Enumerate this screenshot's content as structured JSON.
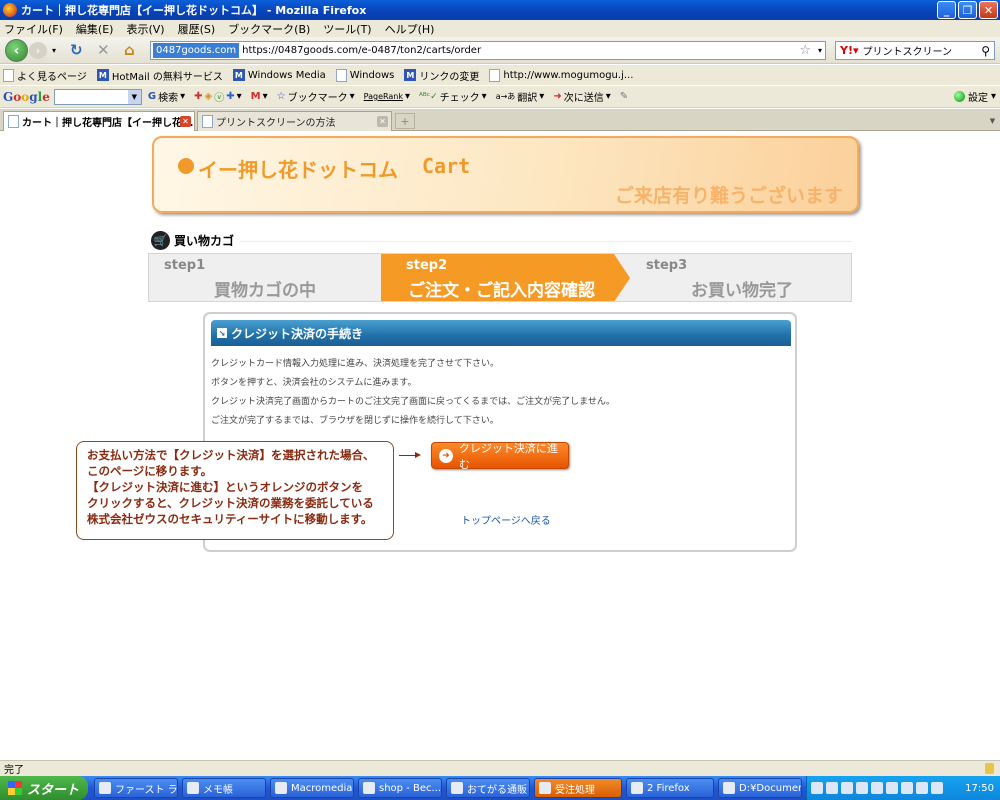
{
  "window": {
    "title": "カート｜押し花専門店【イー押し花ドットコム】 - Mozilla Firefox"
  },
  "menu": [
    "ファイル(F)",
    "編集(E)",
    "表示(V)",
    "履歴(S)",
    "ブックマーク(B)",
    "ツール(T)",
    "ヘルプ(H)"
  ],
  "nav": {
    "site_badge": "0487goods.com",
    "url": "https://0487goods.com/e-0487/ton2/carts/order",
    "search_value": "プリントスクリーン"
  },
  "bookmarks": [
    "よく見るページ",
    "HotMail の無料サービス",
    "Windows Media",
    "Windows",
    "リンクの変更",
    "http://www.mogumogu.j..."
  ],
  "google_toolbar": {
    "logo": {
      "g1": "G",
      "o1": "o",
      "o2": "o",
      "g2": "g",
      "l": "l",
      "e": "e"
    },
    "search_label": "検索",
    "bookmarks_label": "ブックマーク",
    "pagerank_label": "PageRank",
    "check_label": "チェック",
    "translate_label": "翻訳",
    "send_label": "次に送信",
    "settings_label": "設定"
  },
  "tabs": [
    {
      "label": "カート｜押し花専門店【イー押し花...",
      "active": true
    },
    {
      "label": "プリントスクリーンの方法",
      "active": false
    }
  ],
  "banner": {
    "site_name": "イー押し花ドットコム",
    "cart_label": "Cart",
    "thanks": "ご来店有り難うございます"
  },
  "cart_heading": "買い物カゴ",
  "steps": [
    {
      "num": "step1",
      "label": "買物カゴの中",
      "current": false
    },
    {
      "num": "step2",
      "label": "ご注文・ご記入内容確認",
      "current": true
    },
    {
      "num": "step3",
      "label": "お買い物完了",
      "current": false
    }
  ],
  "panel": {
    "title": "クレジット決済の手続き",
    "lines": [
      "クレジットカード情報入力処理に進み、決済処理を完了させて下さい。",
      "ボタンを押すと、決済会社のシステムに進みます。",
      "クレジット決済完了画面からカートのご注文完了画面に戻ってくるまでは、ご注文が完了しません。",
      "ご注文が完了するまでは、ブラウザを閉じずに操作を続行して下さい。"
    ],
    "pay_button": "クレジット決済に進む",
    "top_link": "トップページへ戻る"
  },
  "callout": {
    "lines": [
      "お支払い方法で【クレジット決済】を選択された場合、",
      "このページに移ります。",
      "【クレジット決済に進む】というオレンジのボタンを",
      "クリックすると、クレジット決済の業務を委託している",
      "株式会社ゼウスのセキュリティーサイトに移動します。"
    ]
  },
  "status": "完了",
  "taskbar": {
    "start": "スタート",
    "tasks": [
      "ファースト ラン",
      "メモ帳",
      "Macromedia...",
      "shop - Bec...",
      "おてがる通販",
      "受注処理",
      "2 Firefox",
      "D:¥Documen..."
    ],
    "clock": "17:50"
  }
}
